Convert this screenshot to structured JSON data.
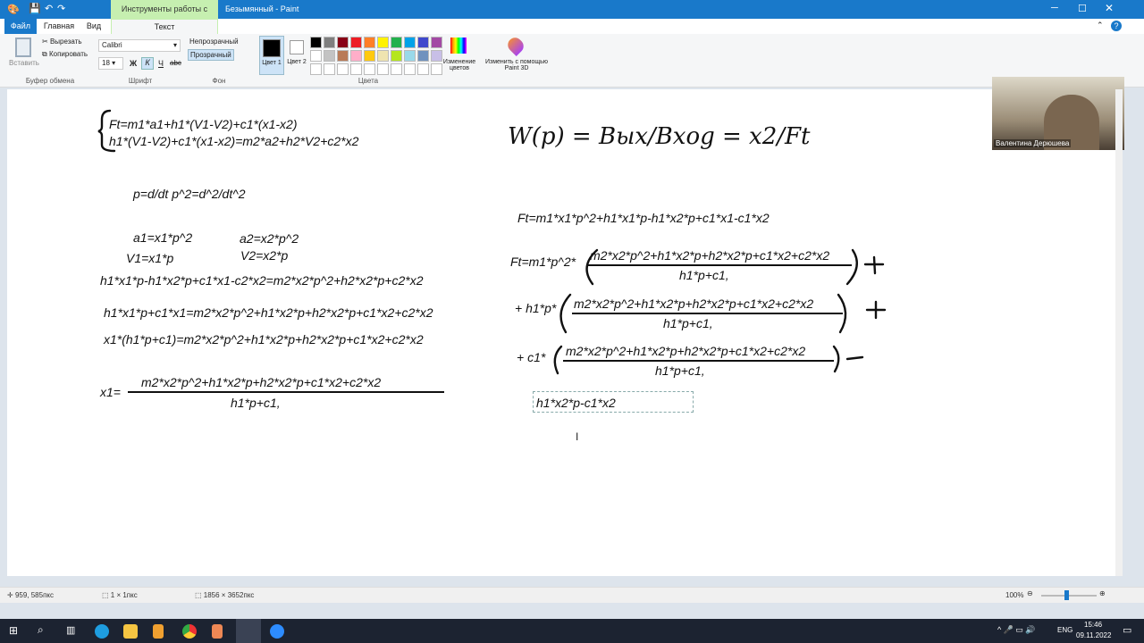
{
  "window": {
    "title": "Безымянный - Paint",
    "context_tab": "Инструменты работы с текстом"
  },
  "tabs": {
    "file": "Файл",
    "home": "Главная",
    "view": "Вид",
    "text": "Текст"
  },
  "ribbon": {
    "paste": "Вставить",
    "cut": "Вырезать",
    "copy": "Копировать",
    "clipboard_group": "Буфер обмена",
    "font_name": "Calibri",
    "font_size": "18",
    "bold": "Ж",
    "italic": "К",
    "underline": "Ч",
    "strike": "abc",
    "font_group": "Шрифт",
    "opaque": "Непрозрачный",
    "transparent": "Прозрачный",
    "bg_group": "Фон",
    "color1": "Цвет 1",
    "color2": "Цвет 2",
    "edit_colors": "Изменение цветов",
    "colors_group": "Цвета",
    "paint3d": "Изменить с помощью Paint 3D",
    "palette": [
      "#000000",
      "#7f7f7f",
      "#880015",
      "#ed1c24",
      "#ff7f27",
      "#fff200",
      "#22b14c",
      "#00a2e8",
      "#3f48cc",
      "#a349a4",
      "#ffffff",
      "#c3c3c3",
      "#b97a57",
      "#ffaec9",
      "#ffc90e",
      "#efe4b0",
      "#b5e61d",
      "#99d9ea",
      "#7092be",
      "#c8bfe7"
    ]
  },
  "canvas": {
    "system": [
      "Ft=m1*a1+h1*(V1-V2)+c1*(x1-x2)",
      "h1*(V1-V2)+c1*(x1-x2)=m2*a2+h2*V2+c2*x2"
    ],
    "p_def": "p=d/dt  p^2=d^2/dt^2",
    "a1": "a1=x1*p^2",
    "v1": "V1=x1*p",
    "a2": "a2=x2*p^2",
    "v2": "V2=x2*p",
    "eq1": "h1*x1*p-h1*x2*p+c1*x1-c2*x2=m2*x2*p^2+h2*x2*p+c2*x2",
    "eq2": "h1*x1*p+c1*x1=m2*x2*p^2+h1*x2*p+h2*x2*p+c1*x2+c2*x2",
    "eq3": "x1*(h1*p+c1)=m2*x2*p^2+h1*x2*p+h2*x2*p+c1*x2+c2*x2",
    "x1_label": "x1=",
    "numerator": "m2*x2*p^2+h1*x2*p+h2*x2*p+c1*x2+c2*x2",
    "denominator": "h1*p+c1,",
    "handwritten": "W(p) = Bых/Bхоg = x2/Ft",
    "ft_eq": "Ft=m1*x1*p^2+h1*x1*p-h1*x2*p+c1*x1-c1*x2",
    "ft_prefix": "Ft=m1*p^2*",
    "h_prefix": "+ h1*p*",
    "c_prefix": "+ c1*",
    "plus": "+",
    "minus": "−",
    "editing_text": "h1*x2*p-c1*x2"
  },
  "video": {
    "name": "Валентина Дерюшева"
  },
  "status": {
    "cursor": "959, 585пкс",
    "selection": "1 × 1пкс",
    "size": "1856 × 3652пкс",
    "zoom": "100%",
    "zoom_level": 100
  },
  "taskbar": {
    "lang": "ENG",
    "time": "15:46",
    "date": "09.11.2022"
  }
}
